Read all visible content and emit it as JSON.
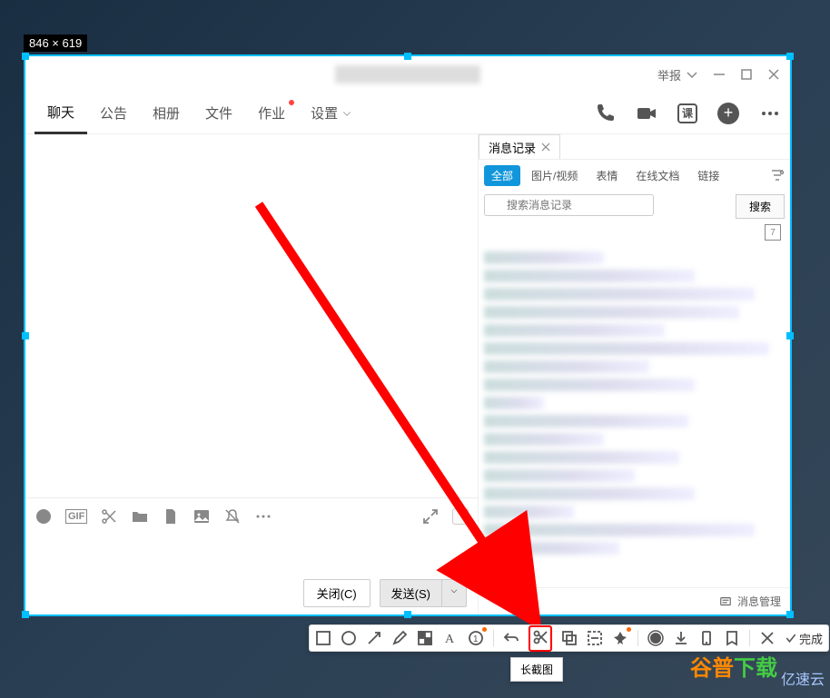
{
  "capture": {
    "dimensions": "846 × 619"
  },
  "titlebar": {
    "report": "举报"
  },
  "tabs": {
    "chat": "聊天",
    "notice": "公告",
    "album": "相册",
    "files": "文件",
    "homework": "作业",
    "settings": "设置"
  },
  "input_buttons": {
    "close": "关闭(C)",
    "send": "发送(S)"
  },
  "side": {
    "tab_label": "消息记录",
    "filters": {
      "all": "全部",
      "media": "图片/视频",
      "emoji": "表情",
      "docs": "在线文档",
      "links": "链接"
    },
    "search_placeholder": "搜索消息记录",
    "search_btn": "搜索",
    "calendar_day": "7",
    "footer": "消息管理"
  },
  "toolbar": {
    "tooltip": "长截图",
    "done": "完成"
  },
  "watermark": {
    "brand_a": "谷普",
    "brand_b": "下载",
    "brand2": "亿速云"
  }
}
